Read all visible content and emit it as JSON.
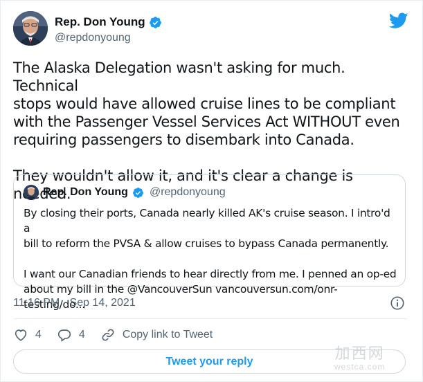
{
  "author": {
    "name": "Rep. Don Young",
    "handle": "@repdonyoung"
  },
  "tweet": {
    "text": "The Alaska Delegation wasn't asking for much. Technical\nstops would have allowed cruise lines to be compliant\nwith the Passenger Vessel Services Act WITHOUT even\nrequiring passengers to disembark into Canada.\n\nThey wouldn't allow it, and it's clear a change is needed."
  },
  "quote": {
    "name": "Rep. Don Young",
    "handle": "@repdonyoung",
    "text": "By closing their ports, Canada nearly killed AK's cruise season. I intro'd a\nbill to reform the PVSA & allow cruises to bypass Canada permanently.\n\nI want our Canadian friends to hear directly from me. I penned an op-ed\nabout my bill in the @VancouverSun vancouversun.com/onr-testing/do..."
  },
  "meta": {
    "timestamp": "11:16 PM · Sep 14, 2021"
  },
  "actions": {
    "likes": "4",
    "replies": "4",
    "copy_link": "Copy link to Tweet"
  },
  "reply_button": "Tweet your reply",
  "watermark": {
    "cn": "加西网",
    "en": "westca.com"
  },
  "colors": {
    "accent": "#1d9bf0",
    "text": "#0f1419",
    "muted": "#536471",
    "border": "#cfd9de"
  },
  "icons": [
    "twitter-bird-icon",
    "verified-badge-icon",
    "info-icon",
    "heart-icon",
    "reply-icon",
    "link-icon"
  ]
}
